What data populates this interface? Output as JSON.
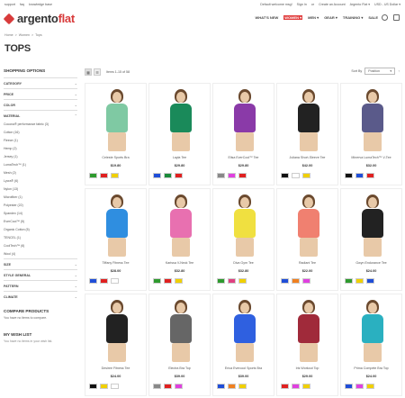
{
  "topbar": {
    "links": [
      "support",
      "faq",
      "knowledge base"
    ],
    "right": [
      "Default welcome msg!",
      "Sign In",
      "or",
      "Create an Account",
      "Argento Flat ▾",
      "USD - US Dollar ▾"
    ]
  },
  "brand": {
    "part1": "argento",
    "part2": "flat",
    "accent": "#d83b3b"
  },
  "nav": {
    "items": [
      "WHAT'S NEW",
      "WOMEN ▾",
      "MEN ▾",
      "GEAR ▾",
      "TRAINING ▾",
      "SALE"
    ],
    "active_index": 1
  },
  "breadcrumb": [
    "Home",
    ">",
    "Women",
    ">",
    "Tops"
  ],
  "page_title": "TOPS",
  "sidebar": {
    "heading": "SHOPPING OPTIONS",
    "filters_top": [
      {
        "label": "CATEGORY",
        "chev": "⌄"
      },
      {
        "label": "PRICE",
        "chev": "⌄"
      },
      {
        "label": "COLOR",
        "chev": "⌄"
      },
      {
        "label": "MATERIAL",
        "chev": "⌃"
      }
    ],
    "material_options": [
      "Cocona® performance fabric (3)",
      "Cotton (16)",
      "Fleece (1)",
      "Hemp (2)",
      "Jersey (1)",
      "LumaTech™ (1)",
      "Mesh (2)",
      "Lycra® (6)",
      "Nylon (13)",
      "Microfiber (1)",
      "Polyester (22)",
      "Spandex (14)",
      "EverCool™ (5)",
      "Organic Cotton (5)",
      "TENCEL (1)",
      "CoolTech™ (6)",
      "Wool (4)"
    ],
    "filters_bottom": [
      {
        "label": "SIZE",
        "chev": "⌄"
      },
      {
        "label": "STYLE GENERAL",
        "chev": "⌄"
      },
      {
        "label": "PATTERN",
        "chev": "⌄"
      },
      {
        "label": "CLIMATE",
        "chev": "⌄"
      }
    ],
    "compare_heading": "COMPARE PRODUCTS",
    "compare_text": "You have no items to compare.",
    "wishlist_heading": "MY WISH LIST",
    "wishlist_text": "You have no items in your wish list."
  },
  "toolbar": {
    "grid_icon": "▦",
    "list_icon": "☰",
    "items_text": "Items 1-15 of 58",
    "sort_label": "Sort By",
    "sort_value": "Position",
    "sort_chev": "▾",
    "sort_dir_icon": "↑"
  },
  "products": [
    {
      "name": "Celeste Sports Bra",
      "price": "$19.80",
      "top": "#7fc9a3",
      "swatches": [
        "#2e9a2e",
        "#e02020",
        "#f0d000"
      ]
    },
    {
      "name": "Layla Tee",
      "price": "$29.80",
      "top": "#1a8a5a",
      "swatches": [
        "#1f4ed8",
        "#1a8a3a",
        "#e02020"
      ]
    },
    {
      "name": "Elisa EverCool™ Tee",
      "price": "$29.80",
      "top": "#8a3aa8",
      "swatches": [
        "#888888",
        "#e040e0",
        "#e02020"
      ]
    },
    {
      "name": "Juliana Short-Sleeve Tee",
      "price": "$42.00",
      "top": "#222222",
      "swatches": [
        "#111111",
        "#ffffff",
        "#f0d000"
      ]
    },
    {
      "name": "Minerva LumaTech™ V-Tee",
      "price": "$32.00",
      "top": "#5a5a8a",
      "swatches": [
        "#111111",
        "#1f4ed8",
        "#e02020"
      ]
    },
    {
      "name": "Tiffany Fitness Tee",
      "price": "$28.00",
      "top": "#2f8ee0",
      "swatches": [
        "#1f4ed8",
        "#e02020",
        "#ffffff"
      ]
    },
    {
      "name": "Karissa V-Neck Tee",
      "price": "$32.80",
      "top": "#e870b0",
      "swatches": [
        "#2e9a2e",
        "#e02020",
        "#f0d000"
      ]
    },
    {
      "name": "Diva Gym Tee",
      "price": "$32.80",
      "top": "#f0e040",
      "swatches": [
        "#2e9a2e",
        "#e04080",
        "#f0d000"
      ]
    },
    {
      "name": "Radiant Tee",
      "price": "$22.00",
      "top": "#f08070",
      "swatches": [
        "#1f4ed8",
        "#f08020",
        "#e040e0"
      ]
    },
    {
      "name": "Gwyn Endurance Tee",
      "price": "$24.00",
      "top": "#222222",
      "swatches": [
        "#2e9a2e",
        "#f0d000",
        "#1f4ed8"
      ]
    },
    {
      "name": "Desiree Fitness Tee",
      "price": "$24.00",
      "top": "#222222",
      "swatches": [
        "#111111",
        "#f0d000",
        "#ffffff"
      ]
    },
    {
      "name": "Electra Bra Top",
      "price": "$39.00",
      "top": "#666666",
      "swatches": [
        "#888888",
        "#e02020",
        "#e040e0"
      ]
    },
    {
      "name": "Erica Evercool Sports Bra",
      "price": "$39.00",
      "top": "#2f60e0",
      "swatches": [
        "#1f4ed8",
        "#f08020",
        "#f0d000"
      ]
    },
    {
      "name": "Iris Workout Top",
      "price": "$29.00",
      "top": "#a02a3a",
      "swatches": [
        "#e02020",
        "#e040e0",
        "#f0d000"
      ]
    },
    {
      "name": "Prima Compete Bra Top",
      "price": "$24.00",
      "top": "#2ab0c0",
      "swatches": [
        "#1f4ed8",
        "#e040e0",
        "#f0d000"
      ]
    }
  ]
}
